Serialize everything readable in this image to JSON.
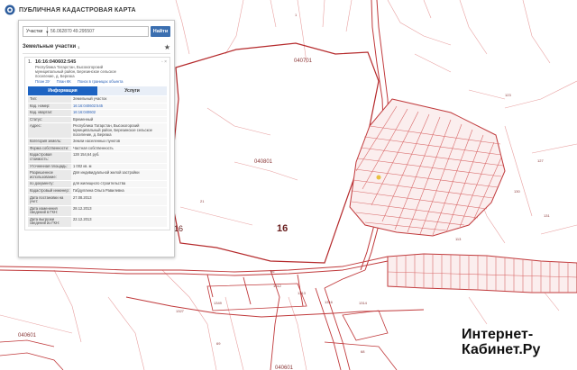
{
  "app": {
    "title": "ПУБЛИЧНАЯ КАДАСТРОВАЯ КАРТА"
  },
  "search": {
    "mode": "Участки",
    "value": "56.062870 49.295507",
    "button": "Найти"
  },
  "results": {
    "header": "Земельные участки",
    "count": "1",
    "item": {
      "index": "1.",
      "cad_number": "16:16:040602:545",
      "address_lines": [
        "Республика Татарстан, Высокогорский",
        "муниципальный район, Березинское сельское",
        "поселение, д. Березка"
      ],
      "links": [
        "План ЗУ",
        "План КК",
        "Поиск в границах объекта"
      ],
      "tabs": {
        "info": "Информация",
        "services": "Услуги"
      },
      "fields": [
        {
          "k": "Тип:",
          "v": "Земельный участок"
        },
        {
          "k": "Кад. номер:",
          "v": "16:16:040602:545",
          "link": true
        },
        {
          "k": "Кад. квартал:",
          "v": "16:16:040602",
          "link": true
        },
        {
          "k": "Статус:",
          "v": "Временный"
        },
        {
          "k": "Адрес:",
          "v": "Республика Татарстан, Высокогорский муниципальный район, Березинское сельское поселение, д. Березка"
        },
        {
          "k": "Категория земель:",
          "v": "Земли населенных пунктов"
        },
        {
          "k": "Форма собственности:",
          "v": "Частная собственность"
        },
        {
          "k": "Кадастровая стоимость:",
          "v": "128 154,64 руб."
        },
        {
          "k": "Уточненная площадь:",
          "v": "1 002 кв. м"
        },
        {
          "k": "Разрешенное использование:",
          "v": "Для индивидуальной жилой застройки"
        },
        {
          "k": "по документу:",
          "v": "для жилищного строительства"
        },
        {
          "k": "Кадастровый инженер:",
          "v": "Габдуллина Ольга Равилевна"
        },
        {
          "k": "Дата постановки на учет:",
          "v": "27.08.2013"
        },
        {
          "k": "Дата изменения сведений в ГКН:",
          "v": "28.12.2013"
        },
        {
          "k": "Дата выгрузки сведений из ГКН:",
          "v": "22.12.2013"
        }
      ]
    }
  },
  "map_labels": {
    "q040701": "040701",
    "q040801": "040801",
    "q040601": "040601",
    "q040601b": "040601",
    "big16a": "16",
    "big16b": "16",
    "n21": "21",
    "n123": "123",
    "n96": "96",
    "n1312": "1312",
    "n1316": "1316",
    "n1314": "1314",
    "n1313": "1313",
    "n1327": "1327",
    "n1349": "1349",
    "n130": "130",
    "n131": "131",
    "n127": "127",
    "n69": "69",
    "n113": "113",
    "n68": "68",
    "n1": "1"
  },
  "watermark": {
    "line1": "Интернет-",
    "line2": "Кабинет.Ру"
  },
  "colors": {
    "accent": "#1d63c2",
    "boundary": "#c0393b",
    "parcel": "#d96a6a"
  }
}
